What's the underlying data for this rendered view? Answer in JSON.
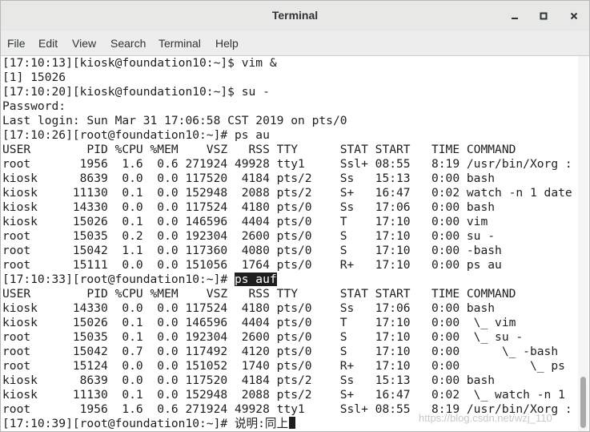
{
  "window": {
    "title": "Terminal"
  },
  "menu": [
    "File",
    "Edit",
    "View",
    "Search",
    "Terminal",
    "Help"
  ],
  "terminal": {
    "lines": [
      "[17:10:13][kiosk@foundation10:~]$ vim &",
      "[1] 15026",
      "[17:10:20][kiosk@foundation10:~]$ su -",
      "Password:",
      "Last login: Sun Mar 31 17:06:58 CST 2019 on pts/0",
      "[17:10:26][root@foundation10:~]# ps au",
      "USER        PID %CPU %MEM    VSZ   RSS TTY      STAT START   TIME COMMAND",
      "root       1956  1.6  0.6 271924 49928 tty1     Ssl+ 08:55   8:19 /usr/bin/Xorg :",
      "kiosk      8639  0.0  0.0 117520  4184 pts/2    Ss   15:13   0:00 bash",
      "kiosk     11130  0.1  0.0 152948  2088 pts/2    S+   16:47   0:02 watch -n 1 date",
      "kiosk     14330  0.0  0.0 117524  4180 pts/0    Ss   17:06   0:00 bash",
      "kiosk     15026  0.1  0.0 146596  4404 pts/0    T    17:10   0:00 vim",
      "root      15035  0.2  0.0 192304  2600 pts/0    S    17:10   0:00 su -",
      "root      15042  1.1  0.0 117360  4080 pts/0    S    17:10   0:00 -bash",
      "root      15111  0.0  0.0 151056  1764 pts/0    R+   17:10   0:00 ps au",
      "[17:10:33][root@foundation10:~]# ",
      "USER        PID %CPU %MEM    VSZ   RSS TTY      STAT START   TIME COMMAND",
      "kiosk     14330  0.0  0.0 117524  4180 pts/0    Ss   17:06   0:00 bash",
      "kiosk     15026  0.1  0.0 146596  4404 pts/0    T    17:10   0:00  \\_ vim",
      "root      15035  0.1  0.0 192304  2600 pts/0    S    17:10   0:00  \\_ su -",
      "root      15042  0.7  0.0 117492  4120 pts/0    S    17:10   0:00      \\_ -bash",
      "root      15124  0.0  0.0 151052  1740 pts/0    R+   17:10   0:00          \\_ ps",
      "kiosk      8639  0.0  0.0 117520  4184 pts/2    Ss   15:13   0:00 bash",
      "kiosk     11130  0.1  0.0 152948  2088 pts/2    S+   16:47   0:02  \\_ watch -n 1",
      "root       1956  1.6  0.6 271924 49928 tty1     Ssl+ 08:55   8:19 /usr/bin/Xorg :",
      "[17:10:39][root@foundation10:~]# 说明:同上"
    ],
    "highlight_text": "ps auf"
  },
  "watermark": "https://blog.csdn.net/wzj_110"
}
